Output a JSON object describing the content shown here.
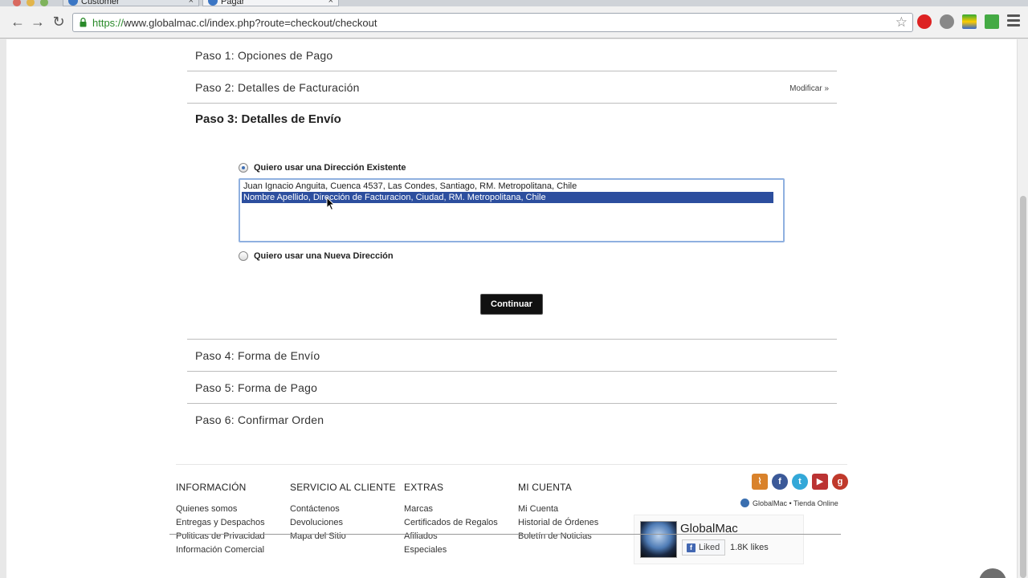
{
  "browser": {
    "tabs": [
      {
        "label": "Customer"
      },
      {
        "label": "Pagar"
      }
    ],
    "url_scheme": "https://",
    "url_rest": "www.globalmac.cl/index.php?route=checkout/checkout"
  },
  "checkout": {
    "step1": "Paso 1: Opciones de Pago",
    "step2": "Paso 2: Detalles de Facturación",
    "modify_label": "Modificar »",
    "step3": "Paso 3: Detalles de Envío",
    "existing_address_label": "Quiero usar una Dirección Existente",
    "addresses": [
      "Juan Ignacio Anguita, Cuenca 4537, Las Condes, Santiago, RM. Metropolitana, Chile",
      "Nombre Apellido, Dirección de Facturacion, Ciudad, RM. Metropolitana, Chile"
    ],
    "selected_address_index": 1,
    "new_address_label": "Quiero usar una Nueva Dirección",
    "continue_label": "Continuar",
    "step4": "Paso 4: Forma de Envío",
    "step5": "Paso 5: Forma de Pago",
    "step6": "Paso 6: Confirmar Orden"
  },
  "footer": {
    "info": {
      "title": "INFORMACIÓN",
      "links": [
        "Quienes somos",
        "Entregas y Despachos",
        "Politicas de Privacidad",
        "Información Comercial"
      ]
    },
    "service": {
      "title": "SERVICIO AL CLIENTE",
      "links": [
        "Contáctenos",
        "Devoluciones",
        "Mapa del Sitio"
      ]
    },
    "extras": {
      "title": "EXTRAS",
      "links": [
        "Marcas",
        "Certificados de Regalos",
        "Afiliados",
        "Especiales"
      ]
    },
    "account": {
      "title": "MI CUENTA",
      "links": [
        "Mi Cuenta",
        "Historial de Órdenes",
        "Boletín de Noticias"
      ]
    },
    "social_icons": [
      "rss-icon",
      "facebook-icon",
      "twitter-icon",
      "youtube-icon",
      "google-plus-icon"
    ],
    "store_label": "GlobalMac • Tienda Online",
    "fb_page_name": "GlobalMac",
    "fb_liked_label": "Liked",
    "fb_likes_count": "1.8K likes"
  },
  "colors": {
    "selected_row": "#2c4e9e",
    "button": "#111111",
    "url_scheme": "#2a8a2a"
  }
}
